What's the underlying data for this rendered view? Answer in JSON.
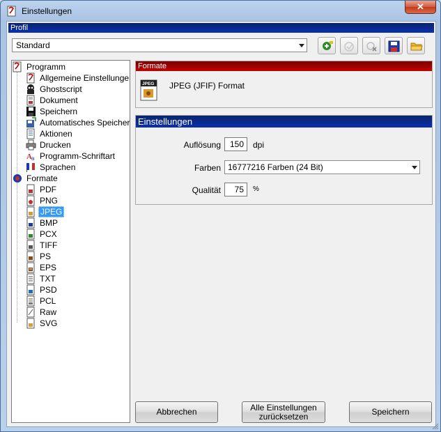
{
  "window": {
    "title": "Einstellungen",
    "close_glyph": "✕"
  },
  "profil": {
    "header": "Profil",
    "selected": "Standard",
    "toolbar_icons": [
      "add-profile-icon",
      "rename-profile-icon",
      "delete-profile-icon",
      "save-profile-icon",
      "open-profile-icon"
    ]
  },
  "tree": {
    "programm": {
      "label": "Programm",
      "items": [
        "Allgemeine Einstellungen",
        "Ghostscript",
        "Dokument",
        "Speichern",
        "Automatisches Speichern",
        "Aktionen",
        "Drucken",
        "Programm-Schriftart",
        "Sprachen"
      ]
    },
    "formate": {
      "label": "Formate",
      "items": [
        "PDF",
        "PNG",
        "JPEG",
        "BMP",
        "PCX",
        "TIFF",
        "PS",
        "EPS",
        "TXT",
        "PSD",
        "PCL",
        "Raw",
        "SVG"
      ],
      "selected": "JPEG"
    }
  },
  "formate_panel": {
    "header": "Formate",
    "format_badge": "JPEG",
    "format_name": "JPEG (JFIF) Format"
  },
  "einstellungen_panel": {
    "header": "Einstellungen",
    "aufloesung_label": "Auflösung",
    "aufloesung_value": "150",
    "aufloesung_unit": "dpi",
    "farben_label": "Farben",
    "farben_value": "16777216 Farben (24 Bit)",
    "qualitaet_label": "Qualität",
    "qualitaet_value": "75",
    "qualitaet_unit": "%"
  },
  "buttons": {
    "abbrechen": "Abbrechen",
    "reset_line1": "Alle Einstellungen",
    "reset_line2": "zurücksetzen",
    "speichern": "Speichern"
  },
  "colors": {
    "header_blue": "#0a246a",
    "header_red": "#c00000",
    "selection": "#3399ff"
  }
}
